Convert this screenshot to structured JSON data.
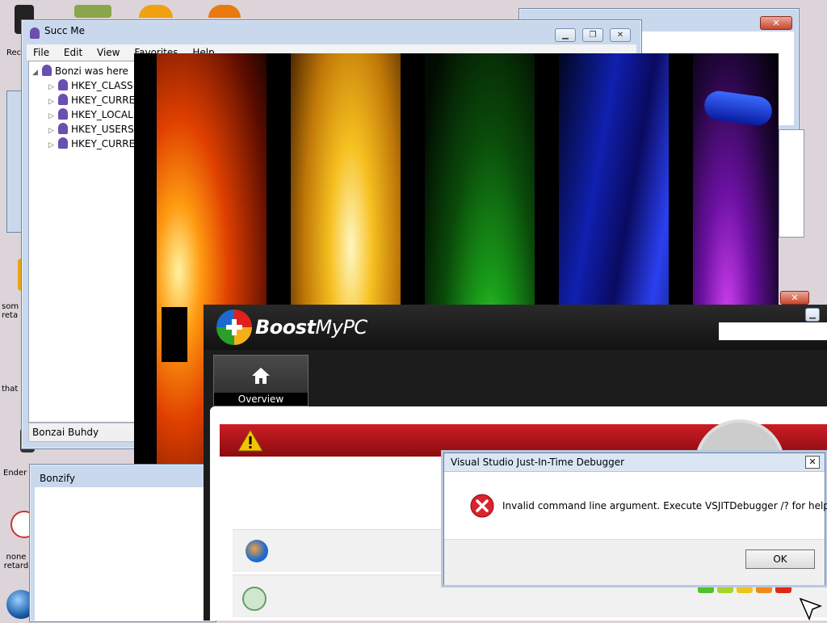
{
  "desktop": {
    "icons": [
      {
        "label": "Rec"
      },
      {
        "label": "som reta"
      },
      {
        "label": "that"
      },
      {
        "label": "Ender"
      },
      {
        "label": "none retard"
      }
    ]
  },
  "regedit": {
    "title": "Succ Me",
    "menu": [
      "File",
      "Edit",
      "View",
      "Favorites",
      "Help"
    ],
    "root": "Bonzi was here",
    "keys": [
      "HKEY_CLASS",
      "HKEY_CURRE",
      "HKEY_LOCAL",
      "HKEY_USERS",
      "HKEY_CURRE"
    ],
    "status": "Bonzai Buhdy"
  },
  "bonzify": {
    "title": "Bonzify"
  },
  "boostmypc": {
    "brand_bold": "Boost",
    "brand_light": "MyPC",
    "tab_label": "Overview"
  },
  "jit_dialog": {
    "title": "Visual Studio Just-In-Time Debugger",
    "close_label": "✕",
    "message": "Invalid command line argument. Execute VSJITDebugger /? for help.",
    "ok_label": "OK"
  },
  "colors": {
    "wallpaper_bands": [
      "#ff5a00",
      "#f4b71a",
      "#1a9e1a",
      "#1a2fd0",
      "#7a1aa8"
    ],
    "alert_red": "#b3141a",
    "error_red": "#d9232e"
  }
}
